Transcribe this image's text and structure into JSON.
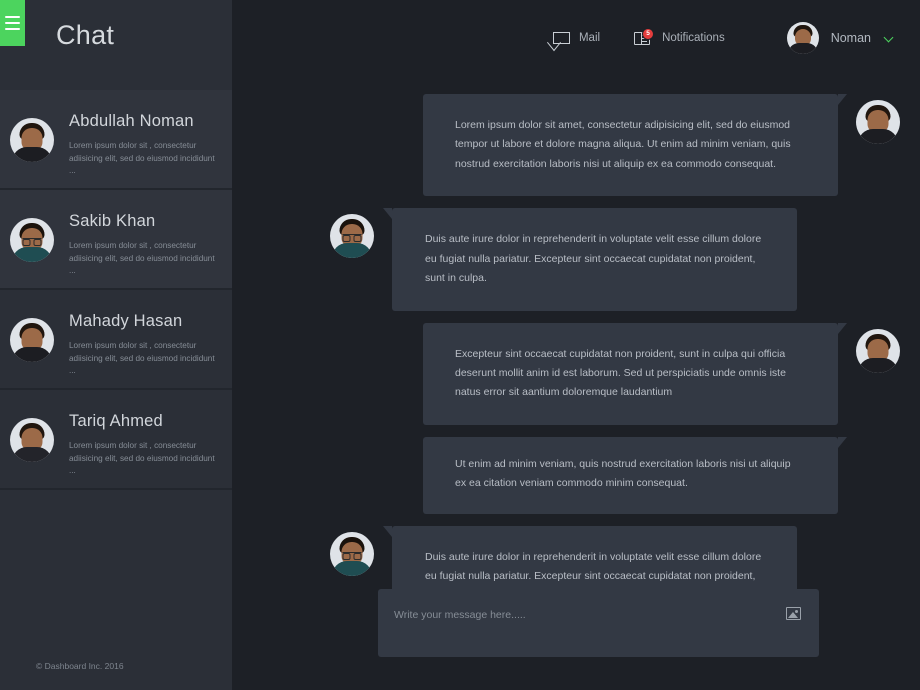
{
  "app": {
    "sidebar_title": "Chat",
    "menu_icon": "hamburger-icon",
    "footer": "© Dashboard Inc. 2016",
    "accent_green": "#4cd45e",
    "sidebar_bg": "#2b2f37",
    "main_bg": "#1d2026",
    "bubble_bg": "#333944"
  },
  "topbar": {
    "mail": {
      "label": "Mail",
      "icon": "envelope-icon"
    },
    "notifications": {
      "label": "Notifications",
      "icon": "book-icon",
      "badge": "5",
      "badge_color": "#e43d3d"
    },
    "user": {
      "name": "Noman",
      "avatar": "user-avatar",
      "chevron": "chevron-down-icon"
    }
  },
  "contacts": [
    {
      "name": "Abdullah Noman",
      "snippet": "Lorem ipsum dolor sit , consectetur adiisicing elit, sed do eiusmod incididunt ...",
      "active": true
    },
    {
      "name": "Sakib Khan",
      "snippet": "Lorem ipsum dolor sit , consectetur adiisicing elit, sed do eiusmod incididunt ...",
      "active": true
    },
    {
      "name": "Mahady Hasan",
      "snippet": "Lorem ipsum dolor sit , consectetur adiisicing elit, sed do eiusmod incididunt ...",
      "active": false
    },
    {
      "name": "Tariq Ahmed",
      "snippet": "Lorem ipsum dolor sit , consectetur adiisicing elit, sed do eiusmod incididunt ...",
      "active": false
    }
  ],
  "messages": [
    {
      "side": "right",
      "text": "Lorem ipsum dolor sit amet, consectetur adipisicing elit, sed do eiusmod tempor ut labore et dolore magna aliqua. Ut enim ad minim veniam, quis nostrud exercitation laboris nisi ut aliquip ex ea commodo consequat."
    },
    {
      "side": "left",
      "text": "Duis aute irure dolor in reprehenderit in voluptate velit esse cillum dolore eu fugiat nulla pariatur. Excepteur sint occaecat cupidatat non proident, sunt in culpa."
    },
    {
      "side": "right",
      "text": "Excepteur sint occaecat cupidatat non proident, sunt in culpa qui officia deserunt mollit anim id est laborum. Sed ut perspiciatis unde omnis iste natus error sit aantium doloremque laudantium"
    },
    {
      "side": "right",
      "text": "Ut enim ad minim veniam, quis nostrud exercitation laboris nisi ut aliquip ex ea citation veniam commodo minim  consequat.",
      "no_avatar": true
    },
    {
      "side": "left",
      "text": "Duis aute irure dolor in reprehenderit in voluptate velit esse cillum dolore eu fugiat nulla pariatur. Excepteur sint occaecat cupidatat non proident, sunt in culpa."
    }
  ],
  "composer": {
    "placeholder": "Write your message here.....",
    "value": "",
    "attach_icon": "image-icon"
  }
}
